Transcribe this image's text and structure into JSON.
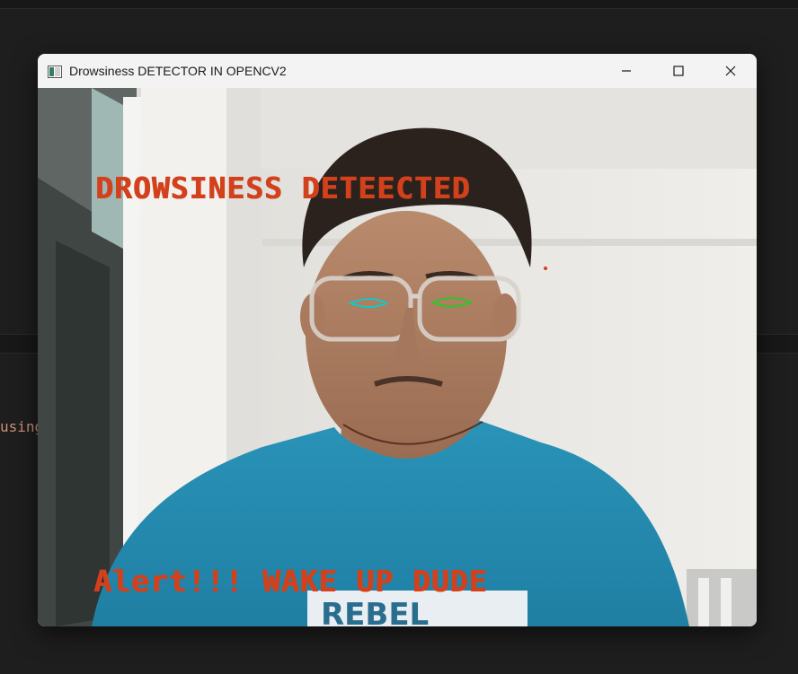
{
  "background": {
    "code_fragment": "using"
  },
  "window": {
    "title": "Drowsiness DETECTOR IN OPENCV2",
    "icon": "opencv-window-icon",
    "controls": {
      "minimize": "minimize-icon",
      "maximize": "maximize-icon",
      "close": "close-icon"
    }
  },
  "video": {
    "alert_top": "DROWSINESS DETEECTED",
    "alert_bottom": "Alert!!! WAKE UP DUDE",
    "shirt_text": "REBEL",
    "overlay_color": "#d3401c",
    "left_eye_contour_color": "#00d0d0",
    "right_eye_contour_color": "#22cc22"
  }
}
